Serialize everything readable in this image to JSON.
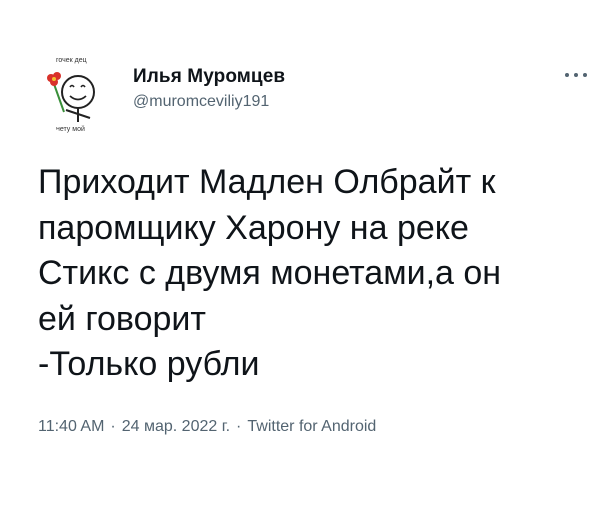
{
  "tweet": {
    "author": {
      "name": "Илья Муромцев",
      "handle": "@muromceviliy191",
      "avatar_caption_top": "гочек дец",
      "avatar_caption_bottom": "нету мой"
    },
    "text": "Приходит Мадлен Олбрайт к\nпаромщику Харону на реке\nСтикс с двумя монетами,а он\nей говорит\n-Только рубли",
    "time": "11:40 AM",
    "date": "24 мар. 2022 г.",
    "separator": "·",
    "source": "Twitter for Android"
  },
  "colors": {
    "text": "#0f1419",
    "secondary": "#536471",
    "flower": "#d9322b",
    "stem": "#3a8f3a"
  },
  "icons": {
    "more": "more-dots-icon"
  }
}
